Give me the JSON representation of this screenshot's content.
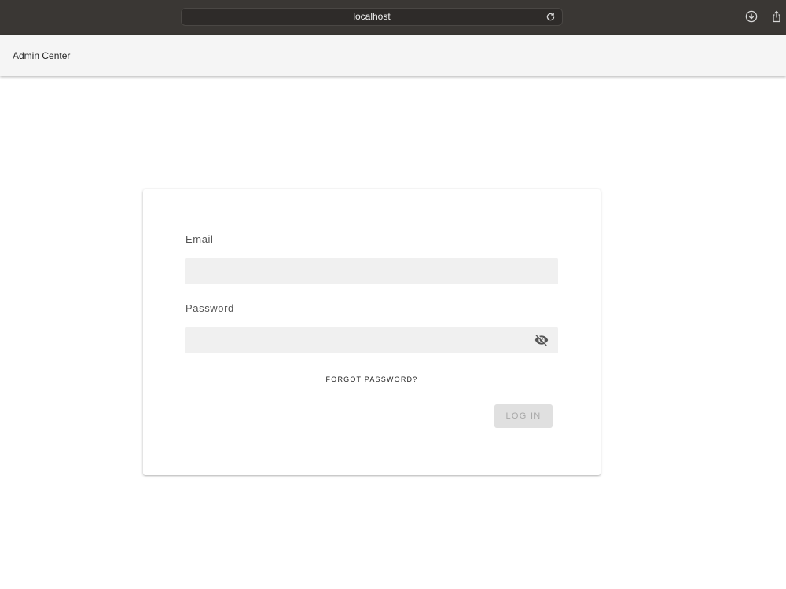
{
  "browser": {
    "url": "localhost",
    "reload_icon": "reload-icon",
    "download_icon": "download-icon",
    "share_icon": "share-icon"
  },
  "header": {
    "title": "Admin Center"
  },
  "login": {
    "email_label": "Email",
    "email_value": "",
    "password_label": "Password",
    "password_value": "",
    "visibility_icon": "eye-off-icon",
    "forgot_password": "FORGOT PASSWORD?",
    "login_button": "LOG IN",
    "login_enabled": false
  },
  "colors": {
    "browser_bar": "#3a3734",
    "header_bg": "#f5f5f5",
    "field_bg": "#f0f0f0",
    "button_disabled_bg": "#e0e0e0",
    "button_disabled_text": "#a8a8a8"
  }
}
